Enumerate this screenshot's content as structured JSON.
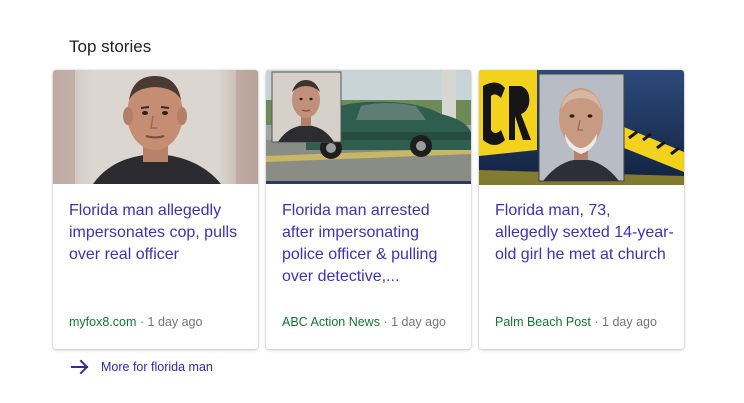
{
  "section": {
    "title": "Top stories"
  },
  "stories": [
    {
      "headline": "Florida man allegedly impersonates cop, pulls over real officer",
      "source": "myfox8.com",
      "time": "1 day ago"
    },
    {
      "headline": "Florida man arrested after impersonating police officer & pulling over detective,...",
      "source": "ABC Action News",
      "time": "1 day ago"
    },
    {
      "headline": "Florida man, 73, allegedly sexted 14-year-old girl he met at church",
      "source": "Palm Beach Post",
      "time": "1 day ago"
    }
  ],
  "more": {
    "label": "More for florida man",
    "icon": "arrow-right-icon"
  },
  "colors": {
    "link": "#3b33b3",
    "source": "#137333",
    "meta": "#70757a"
  }
}
